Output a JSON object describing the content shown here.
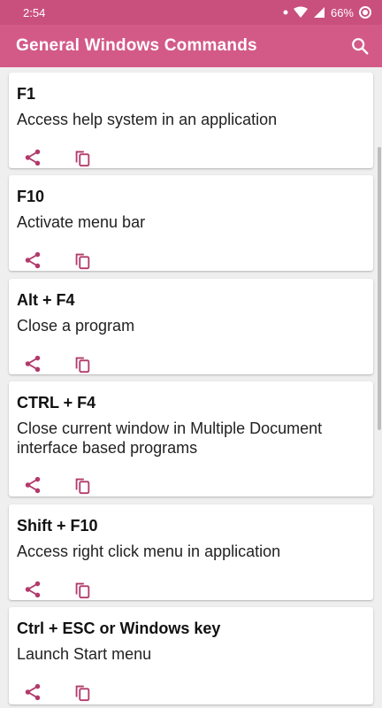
{
  "status": {
    "time": "2:54",
    "battery": "66%"
  },
  "app_bar": {
    "title": "General Windows Commands"
  },
  "commands": [
    {
      "key": "F1",
      "description": "Access help system in an application"
    },
    {
      "key": "F10",
      "description": "Activate menu bar"
    },
    {
      "key": "Alt + F4",
      "description": "Close a program"
    },
    {
      "key": "CTRL + F4",
      "description": "Close current window in Multiple Document interface based programs"
    },
    {
      "key": "Shift + F10",
      "description": "Access right click menu in application"
    },
    {
      "key": "Ctrl + ESC or Windows key",
      "description": "Launch Start menu"
    }
  ],
  "colors": {
    "status_bar": "#c94f7c",
    "app_bar": "#d35a87",
    "accent_icon": "#b23a6b"
  },
  "icons": {
    "share": "share-icon",
    "copy": "copy-icon",
    "search": "search-icon"
  }
}
